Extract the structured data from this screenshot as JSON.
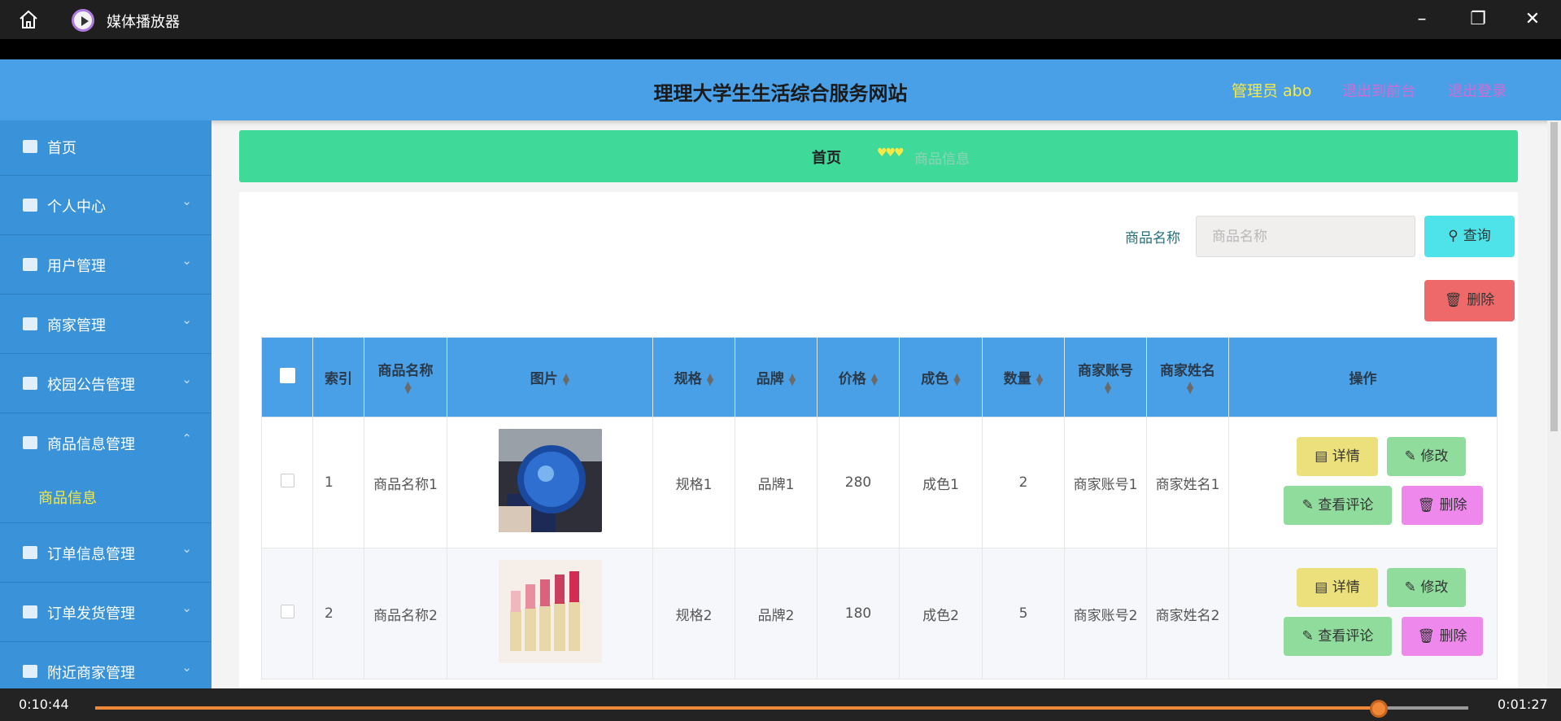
{
  "window": {
    "title": "媒体播放器"
  },
  "header": {
    "site_title": "理理大学生生活综合服务网站",
    "admin": "管理员 abo",
    "link_frontend": "退出到前台",
    "link_logout": "退出登录"
  },
  "sidebar": {
    "items": [
      {
        "label": "首页",
        "icon": "home-icon"
      },
      {
        "label": "个人中心",
        "icon": "user-icon"
      },
      {
        "label": "用户管理",
        "icon": "list-icon"
      },
      {
        "label": "商家管理",
        "icon": "shop-icon"
      },
      {
        "label": "校园公告管理",
        "icon": "notice-icon"
      },
      {
        "label": "商品信息管理",
        "icon": "box-icon"
      },
      {
        "label": "订单信息管理",
        "icon": "order-icon"
      },
      {
        "label": "订单发货管理",
        "icon": "ship-icon"
      },
      {
        "label": "附近商家管理",
        "icon": "map-icon"
      }
    ],
    "active_sub": "商品信息"
  },
  "breadcrumb": {
    "home": "首页",
    "current": "商品信息"
  },
  "search": {
    "label": "商品名称",
    "placeholder": "商品名称",
    "query_button": "查询",
    "delete_button": "删除"
  },
  "table": {
    "headers": [
      "索引",
      "商品名称",
      "图片",
      "规格",
      "品牌",
      "价格",
      "成色",
      "数量",
      "商家账号",
      "商家姓名",
      "操作"
    ],
    "rows": [
      {
        "index": "1",
        "name": "商品名称1",
        "spec": "规格1",
        "brand": "品牌1",
        "price": "280",
        "condition": "成色1",
        "qty": "2",
        "account": "商家账号1",
        "merchant": "商家姓名1"
      },
      {
        "index": "2",
        "name": "商品名称2",
        "spec": "规格2",
        "brand": "品牌2",
        "price": "180",
        "condition": "成色2",
        "qty": "5",
        "account": "商家账号2",
        "merchant": "商家姓名2"
      }
    ],
    "actions": {
      "detail": "详情",
      "edit": "修改",
      "review": "查看评论",
      "delete": "删除"
    }
  },
  "player": {
    "elapsed": "0:10:44",
    "remaining": "0:01:27",
    "progress": 0.935
  },
  "colors": {
    "header": "#4aa0e6",
    "sidebar": "#3a93d9",
    "breadcrumb": "#3fd99a",
    "accent": "#f0883a"
  }
}
